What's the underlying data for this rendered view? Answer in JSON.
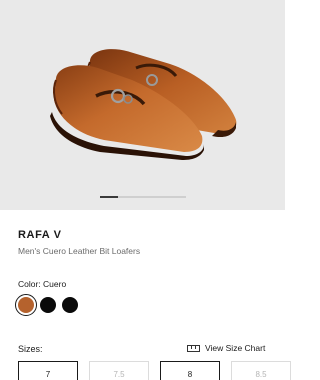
{
  "product": {
    "name": "RAFA V",
    "description": "Men's Cuero Leather Bit Loafers",
    "color_label": "Color: Cuero",
    "colors": [
      {
        "name": "Cuero",
        "hex": "#b5622d",
        "selected": true
      },
      {
        "name": "Black",
        "hex": "#0a0a0a",
        "selected": false
      },
      {
        "name": "Black 2",
        "hex": "#0a0a0a",
        "selected": false
      }
    ]
  },
  "carousel": {
    "slide_count": 4,
    "active_index": 0
  },
  "sizes": {
    "label": "Sizes:",
    "size_chart_label": "View Size Chart",
    "options": [
      {
        "label": "7",
        "available": true
      },
      {
        "label": "7.5",
        "available": false
      },
      {
        "label": "8",
        "available": true
      },
      {
        "label": "8.5",
        "available": false
      }
    ]
  }
}
